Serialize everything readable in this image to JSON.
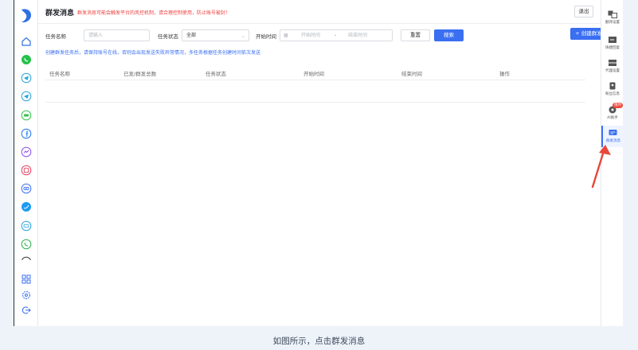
{
  "header": {
    "title": "群发消息",
    "warning": "群发消息可能会触发平台的风控机制，请合理控制使用，防止账号被封！",
    "exit_label": "退出"
  },
  "filters": {
    "task_name_label": "任务名称",
    "task_name_placeholder": "请输入",
    "task_status_label": "任务状态",
    "task_status_value": "全部",
    "start_time_label": "开始时间",
    "start_placeholder": "开始时间",
    "range_separator": "-",
    "end_placeholder": "结束时间",
    "reset_label": "重置",
    "search_label": "搜索",
    "create_label": "+ 创建群发"
  },
  "hint": "创建群发任务后，请保持账号在线，否则会出现发送失败异常情况，多任务根据任务创建时间依次发送",
  "table": {
    "columns": [
      "任务名称",
      "已发/群发总数",
      "任务状态",
      "开始时间",
      "结束时间",
      "操作"
    ]
  },
  "right_panel": {
    "items": [
      {
        "label": "翻译设置",
        "icon": "translate-icon"
      },
      {
        "label": "快捷回复",
        "icon": "quick-reply-icon"
      },
      {
        "label": "代理设置",
        "icon": "proxy-icon"
      },
      {
        "label": "粉丝信息",
        "icon": "fans-info-icon"
      },
      {
        "label": "AI助手",
        "icon": "ai-assistant-icon",
        "badge": "限时"
      },
      {
        "label": "群发消息",
        "icon": "mass-message-icon",
        "active": true
      }
    ]
  },
  "left_sidebar": {
    "icons": [
      "home-icon",
      "whatsapp-icon",
      "telegram-icon",
      "telegram-icon",
      "line-icon",
      "facebook-icon",
      "messenger-icon",
      "instagram-icon",
      "tiktok-icon",
      "twitter-icon",
      "zalo-icon",
      "viber-icon",
      "more-icon",
      "grid-icon",
      "settings-icon",
      "logout-icon"
    ]
  },
  "caption": "如图所示，点击群发消息",
  "colors": {
    "accent": "#3a6ff2",
    "warning": "#ef4141",
    "arrow": "#e8473a"
  }
}
